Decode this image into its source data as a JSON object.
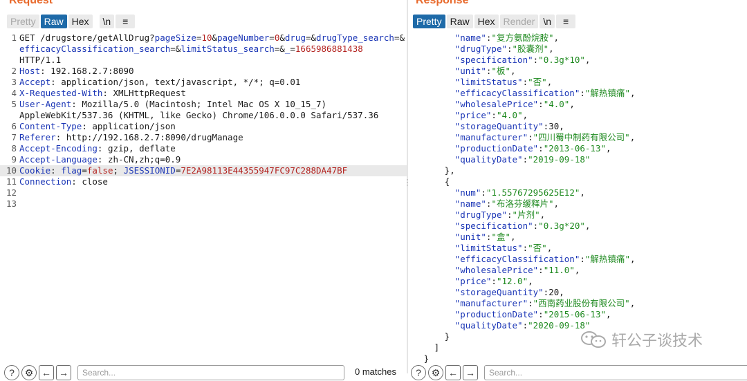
{
  "request": {
    "title": "Request",
    "tabs": {
      "pretty": "Pretty",
      "raw": "Raw",
      "hex": "Hex",
      "newline": "\\n"
    },
    "line_numbers": [
      "1",
      "2",
      "3",
      "4",
      "5",
      "6",
      "7",
      "8",
      "9",
      "10",
      "11",
      "12",
      "13"
    ],
    "line1": {
      "prefix": "GET /drugstore/getAllDrug?",
      "p1k": "pageSize",
      "p1v": "10",
      "p2k": "pageNumber",
      "p2v": "0",
      "p3k": "drug",
      "p4k": "drugType_search",
      "p5k": "efficacyClassification_search",
      "p6k": "limitStatus_search",
      "p7k": "_",
      "p7v": "1665986881438",
      "suffix": "HTTP/1.1"
    },
    "headers": [
      {
        "k": "Host",
        "v": "192.168.2.7:8090"
      },
      {
        "k": "Accept",
        "v": "application/json, text/javascript, */*; q=0.01"
      },
      {
        "k": "X-Requested-With",
        "v": "XMLHttpRequest"
      },
      {
        "k": "User-Agent",
        "v": "Mozilla/5.0 (Macintosh; Intel Mac OS X 10_15_7)",
        "v2": "AppleWebKit/537.36 (KHTML, like Gecko) Chrome/106.0.0.0 Safari/537.36"
      },
      {
        "k": "Content-Type",
        "v": "application/json"
      },
      {
        "k": "Referer",
        "v": "http://192.168.2.7:8090/drugManage"
      },
      {
        "k": "Accept-Encoding",
        "v": "gzip, deflate"
      },
      {
        "k": "Accept-Language",
        "v": "zh-CN,zh;q=0.9"
      }
    ],
    "cookie": {
      "k": "Cookie",
      "c1k": "flag",
      "c1v": "false",
      "c2k": "JSESSIONID",
      "c2v": "7E2A98113E44355947FC97C288DA47BF"
    },
    "connection": {
      "k": "Connection",
      "v": "close"
    },
    "search_placeholder": "Search...",
    "matches": "0 matches"
  },
  "response": {
    "title": "Response",
    "tabs": {
      "pretty": "Pretty",
      "raw": "Raw",
      "hex": "Hex",
      "render": "Render",
      "newline": "\\n"
    },
    "item1": {
      "name": "复方氨酚烷胺",
      "drugType": "胶囊剂",
      "specification": "0.3g*10",
      "unit": "板",
      "limitStatus": "否",
      "efficacyClassification": "解热镇痛",
      "wholesalePrice": "4.0",
      "price": "4.0",
      "storageQuantity": "30",
      "manufacturer": "四川蜀中制药有限公司",
      "productionDate": "2013-06-13",
      "qualityDate": "2019-09-18"
    },
    "item2": {
      "num": "1.55767295625E12",
      "name": "布洛芬缓释片",
      "drugType": "片剂",
      "specification": "0.3g*20",
      "unit": "盒",
      "limitStatus": "否",
      "efficacyClassification": "解热镇痛",
      "wholesalePrice": "11.0",
      "price": "12.0",
      "storageQuantity": "20",
      "manufacturer": "西南药业股份有限公司",
      "productionDate": "2015-06-13",
      "qualityDate": "2020-09-18"
    },
    "search_placeholder": "Search..."
  },
  "watermark": {
    "text": "轩公子谈技术"
  },
  "colors": {
    "accent": "#e8692b",
    "active_tab": "#1e6aa8",
    "key": "#1b36b6",
    "string": "#1f8a20",
    "param_value": "#b3221f"
  }
}
